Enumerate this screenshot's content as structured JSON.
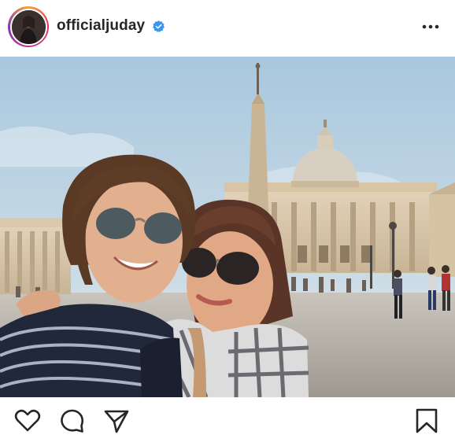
{
  "post": {
    "username": "officialjuday",
    "verified": true,
    "icons": {
      "avatar": "profile-avatar",
      "verified": "verified-badge-icon",
      "more": "more-options-icon",
      "like": "heart-icon",
      "comment": "comment-icon",
      "share": "send-icon",
      "save": "bookmark-icon"
    },
    "colors": {
      "verified": "#3897f0",
      "text": "#262626",
      "sky": "#a9c8df"
    }
  }
}
